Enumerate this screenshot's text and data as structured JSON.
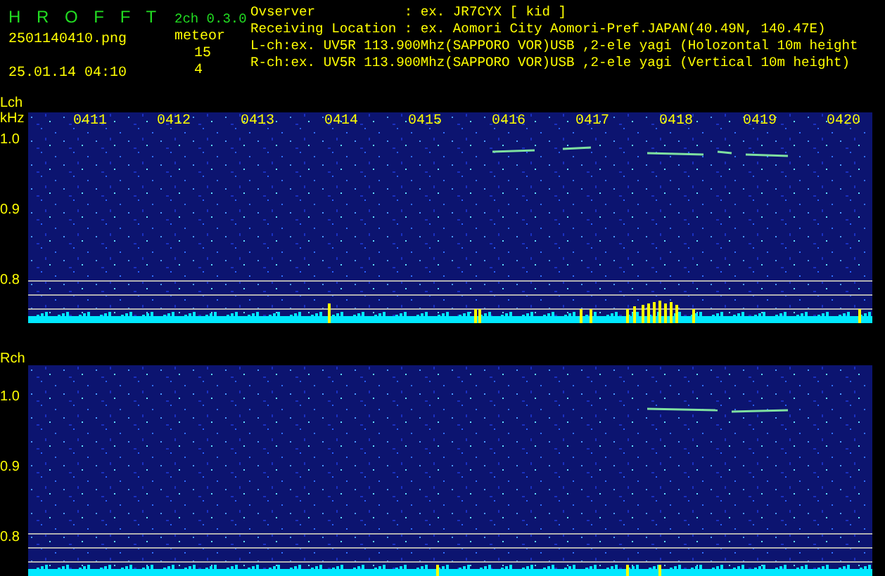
{
  "app": {
    "title": "H R O F F T",
    "version": "2ch 0.3.0",
    "filename": "2501140410.png",
    "datetime": "25.01.14 04:10",
    "meteor_label": "meteor",
    "counts": [
      "15",
      "4"
    ]
  },
  "info_lines": [
    "Ovserver           : ex. JR7CYX [ kid ]",
    "Receiving Location : ex. Aomori City Aomori-Pref.JAPAN(40.49N, 140.47E)",
    "L-ch:ex. UV5R 113.900Mhz(SAPPORO VOR)USB ,2-ele yagi (Holozontal 10m height",
    "R-ch:ex. UV5R 113.900Mhz(SAPPORO VOR)USB ,2-ele yagi (Vertical 10m height)"
  ],
  "panels": [
    {
      "channel": "Lch",
      "unit": "kHz",
      "times": [
        "0411",
        "0412",
        "0413",
        "0414",
        "0415",
        "0416",
        "0417",
        "0418",
        "0419",
        "0420"
      ],
      "yticks": [
        "1.0",
        "0.9",
        "0.8"
      ]
    },
    {
      "channel": "Rch",
      "yticks": [
        "1.0",
        "0.9",
        "0.8"
      ]
    }
  ]
}
